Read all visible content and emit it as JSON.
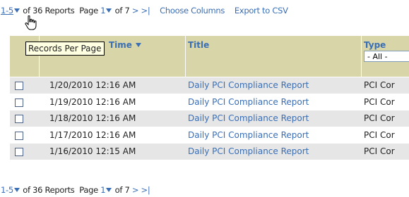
{
  "top_pager": {
    "range": "1-5",
    "summary": "of 36 Reports",
    "page_label": "Page",
    "page_num": "1",
    "of_pages": "of 7",
    "next": ">",
    "last": ">|",
    "choose_columns": "Choose Columns",
    "export": "Export to CSV"
  },
  "tooltip": "Records Per Page",
  "columns": {
    "time": "Time",
    "title": "Title",
    "type": "Type",
    "type_filter": "- All -"
  },
  "rows": [
    {
      "time": "1/20/2010 12:16 AM",
      "title": "Daily PCI Compliance Report",
      "type": "PCI Cor"
    },
    {
      "time": "1/19/2010 12:16 AM",
      "title": "Daily PCI Compliance Report",
      "type": "PCI Cor"
    },
    {
      "time": "1/18/2010 12:16 AM",
      "title": "Daily PCI Compliance Report",
      "type": "PCI Cor"
    },
    {
      "time": "1/17/2010 12:16 AM",
      "title": "Daily PCI Compliance Report",
      "type": "PCI Cor"
    },
    {
      "time": "1/16/2010 12:15 AM",
      "title": "Daily PCI Compliance Report",
      "type": "PCI Cor"
    }
  ],
  "bottom_pager": {
    "range": "1-5",
    "summary": "of 36 Reports",
    "page_label": "Page",
    "page_num": "1",
    "of_pages": "of 7",
    "next": ">",
    "last": ">|"
  },
  "colors": {
    "link": "#3a6eb5",
    "header_bg": "#d8d6a8",
    "row_alt": "#e6e6e6",
    "tooltip_bg": "#ffffe1"
  }
}
